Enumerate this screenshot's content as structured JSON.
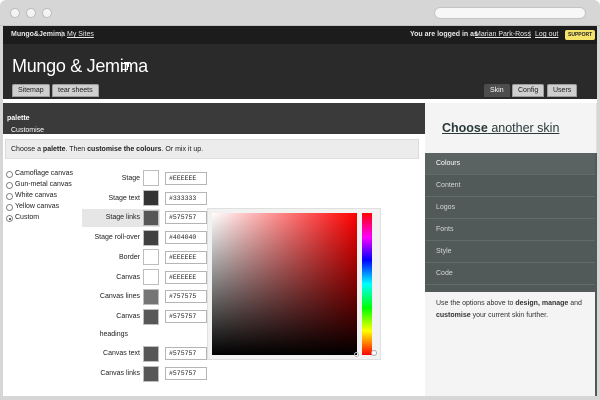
{
  "topbar": {
    "site_name": "Mungo&Jemima",
    "separator": "|",
    "my_sites": "My Sites",
    "logged_in": "You are logged in as",
    "user_name": "Marian Park-Ross",
    "separator2": "|",
    "logout": "Log out",
    "support": "SUPPORT"
  },
  "header": {
    "title": "Mungo & Jemima",
    "left_tabs": [
      "Sitemap",
      "tear sheets"
    ],
    "right_tabs": [
      "Skin",
      "Config",
      "Users"
    ],
    "active_tab": "Skin"
  },
  "palette_panel": {
    "heading_prefix": "Customise your ",
    "heading_bold": "palette",
    "instruction": {
      "p1": "Choose a ",
      "b1": "palette",
      "p2": ". Then ",
      "b2": "customise the colours",
      "p3": ". Or mix it up."
    },
    "presets": [
      {
        "label": "Camoflage canvas",
        "selected": false
      },
      {
        "label": "Gun-metal canvas",
        "selected": false
      },
      {
        "label": "White canvas",
        "selected": false
      },
      {
        "label": "Yellow canvas",
        "selected": false
      },
      {
        "label": "Custom",
        "selected": true
      }
    ],
    "colors": [
      {
        "label": "Stage",
        "hex": "#EEEEEE",
        "swatch": "#FFFFFF"
      },
      {
        "label": "Stage text",
        "hex": "#333333",
        "swatch": "#333333"
      },
      {
        "label": "Stage links",
        "hex": "#575757",
        "swatch": "#575757"
      },
      {
        "label": "Stage roll-over",
        "hex": "#404040",
        "swatch": "#404040"
      },
      {
        "label": "Border",
        "hex": "#EEEEEE",
        "swatch": "#FFFFFF"
      },
      {
        "label": "Canvas",
        "hex": "#EEEEEE",
        "swatch": "#FFFFFF"
      },
      {
        "label": "Canvas lines",
        "hex": "#757575",
        "swatch": "#757575"
      },
      {
        "label": "Canvas",
        "label2": "headings",
        "hex": "#575757",
        "swatch": "#575757"
      },
      {
        "label": "Canvas text",
        "hex": "#575757",
        "swatch": "#575757"
      },
      {
        "label": "Canvas links",
        "hex": "#575757",
        "swatch": "#575757"
      }
    ],
    "highlighted_row": "Stage links"
  },
  "picker": {
    "hue_color": "#FF0000"
  },
  "sidebar": {
    "heading_bold": "Choose",
    "heading_rest": " another skin",
    "items": [
      "Colours",
      "Content",
      "Logos",
      "Fonts",
      "Style",
      "Code"
    ],
    "active_item": "Colours",
    "description": {
      "p1": "Use the options above to ",
      "b1": "design, manage",
      "p2": " and ",
      "b2": "customise",
      "p3": " your current skin further."
    }
  }
}
